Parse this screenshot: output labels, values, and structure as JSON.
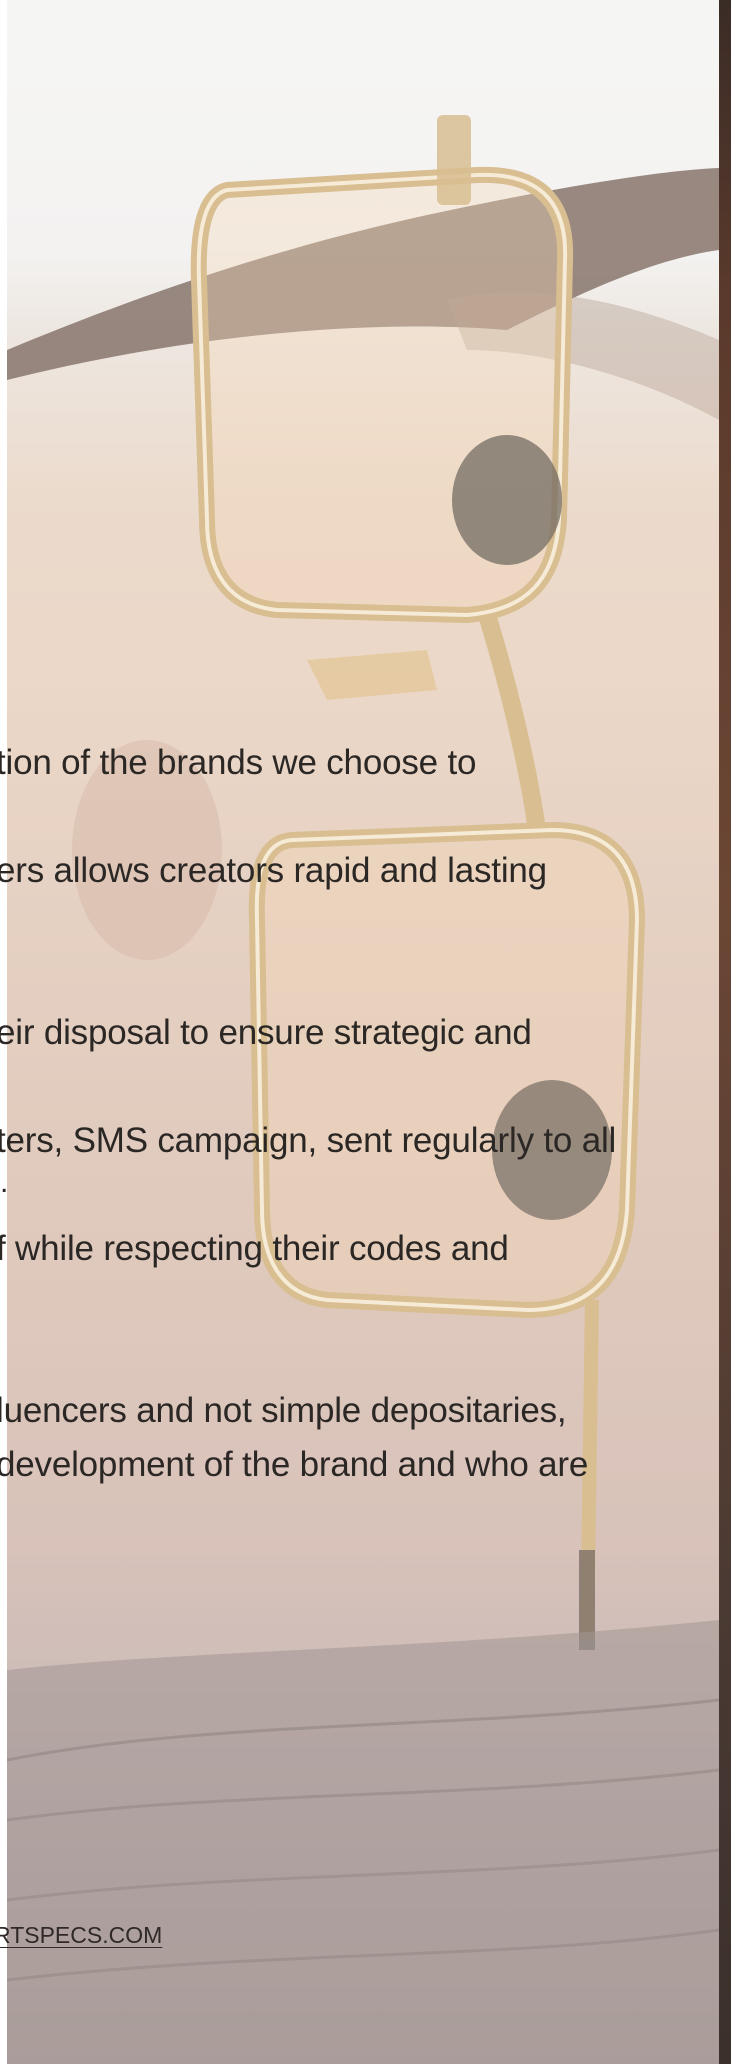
{
  "hero": {
    "image_alt": "Close-up of a face wearing gold-framed octagonal eyeglasses"
  },
  "body_lines": [
    "tion of the brands we choose to",
    "ers allows creators rapid and lasting",
    "eir disposal to ensure strategic and",
    "ters, SMS campaign, sent regularly to all",
    "f while respecting their codes and",
    "luencers and not simple depositaries,",
    " development of the brand and who are"
  ],
  "fragment": ".",
  "footer": {
    "site_link": "RTSPECS.COM"
  },
  "colors": {
    "text": "#2b2725",
    "frame_gold": "#c9a566"
  }
}
